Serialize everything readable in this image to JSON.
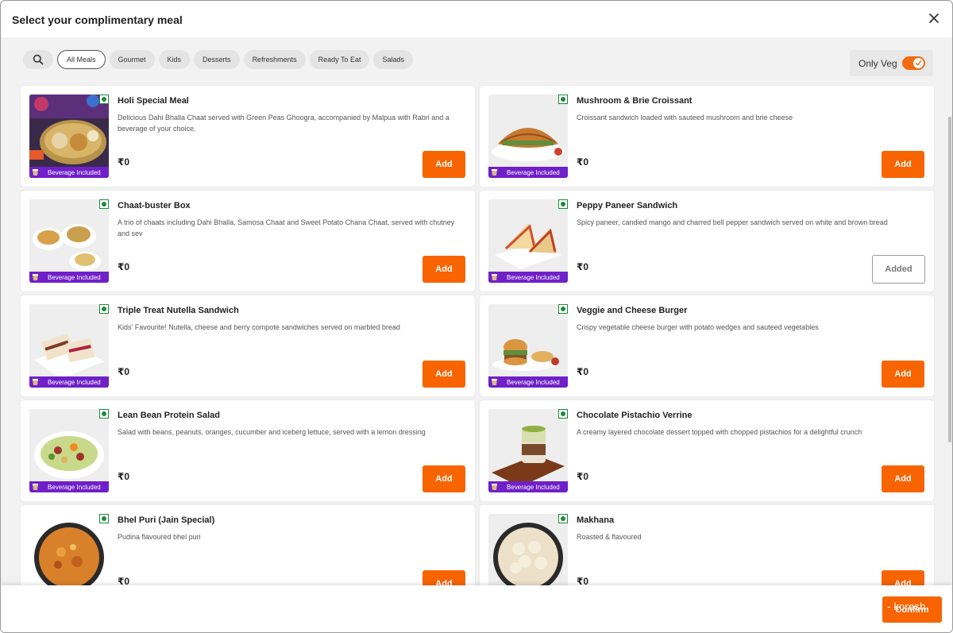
{
  "header": {
    "title": "Select your complimentary meal",
    "close_icon": "close-icon"
  },
  "filters": {
    "search_icon": "search-icon",
    "chips": [
      "All Meals",
      "Gourmet",
      "Kids",
      "Desserts",
      "Refreshments",
      "Ready To Eat",
      "Salads"
    ],
    "active_chip": "All Meals"
  },
  "veg_toggle": {
    "label": "Only Veg",
    "enabled": true
  },
  "badge_text": "Beverage Included",
  "meals": [
    {
      "name": "Holi Special Meal",
      "desc": "Delicious Dahi Bhalla Chaat served with Green Peas Ghoogra, accompanied by Malpua with Rabri and a beverage of your choice.",
      "price": "₹0",
      "button": "Add",
      "beverage": true,
      "img": "platter"
    },
    {
      "name": "Mushroom & Brie Croissant",
      "desc": "Croissant sandwich loaded with sauteed mushroom and brie cheese",
      "price": "₹0",
      "button": "Add",
      "beverage": true,
      "img": "croissant"
    },
    {
      "name": "Chaat-buster Box",
      "desc": "A trio of chaats including Dahi Bhalla, Samosa Chaat and Sweet Potato Chana Chaat, served with chutney and sev",
      "price": "₹0",
      "button": "Add",
      "beverage": true,
      "img": "trio"
    },
    {
      "name": "Peppy Paneer Sandwich",
      "desc": "Spicy paneer, candied mango and charred bell pepper sandwich served on white and brown bread",
      "price": "₹0",
      "button": "Added",
      "beverage": true,
      "img": "sandwich"
    },
    {
      "name": "Triple Treat Nutella Sandwich",
      "desc": "Kids' Favourite! Nutella, cheese and berry compote sandwiches served on marbled bread",
      "price": "₹0",
      "button": "Add",
      "beverage": true,
      "img": "sandwich2"
    },
    {
      "name": "Veggie and Cheese Burger",
      "desc": "Crispy vegetable cheese burger with potato wedges and sauteed vegetables",
      "price": "₹0",
      "button": "Add",
      "beverage": true,
      "img": "burger"
    },
    {
      "name": "Lean Bean Protein Salad",
      "desc": "Salad with beans, peanuts, oranges, cucumber and iceberg lettuce, served with a lemon dressing",
      "price": "₹0",
      "button": "Add",
      "beverage": true,
      "img": "salad"
    },
    {
      "name": "Chocolate Pistachio Verrine",
      "desc": "A creamy layered chocolate dessert topped with chopped pistachios for a delightful crunch",
      "price": "₹0",
      "button": "Add",
      "beverage": true,
      "img": "verrine"
    },
    {
      "name": "Bhel Puri (Jain Special)",
      "desc": "Pudina flavoured bhel puri",
      "price": "₹0",
      "button": "Add",
      "beverage": false,
      "img": "bhel"
    },
    {
      "name": "Makhana",
      "desc": "Roasted & flavoured",
      "price": "₹0",
      "button": "Add",
      "beverage": false,
      "img": "makhana"
    }
  ],
  "footer": {
    "confirm_label": "Confirm",
    "overlay_text": "- koresh"
  },
  "colors": {
    "accent": "#f76400",
    "veg_green": "#1f8a3a",
    "beverage_purple": "#6f20c8"
  }
}
